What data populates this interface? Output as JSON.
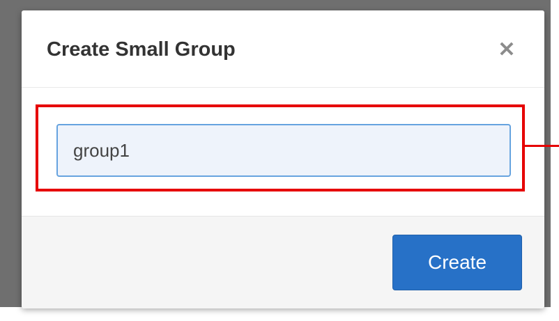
{
  "dialog": {
    "title": "Create Small Group",
    "close_glyph": "✕",
    "close_icon": "close-icon"
  },
  "form": {
    "group_name_value": "group1"
  },
  "footer": {
    "create_label": "Create"
  },
  "colors": {
    "primary_button": "#2771c7",
    "highlight": "#e60000",
    "input_focus_border": "#66a3df",
    "backdrop": "#6f6f6f"
  }
}
